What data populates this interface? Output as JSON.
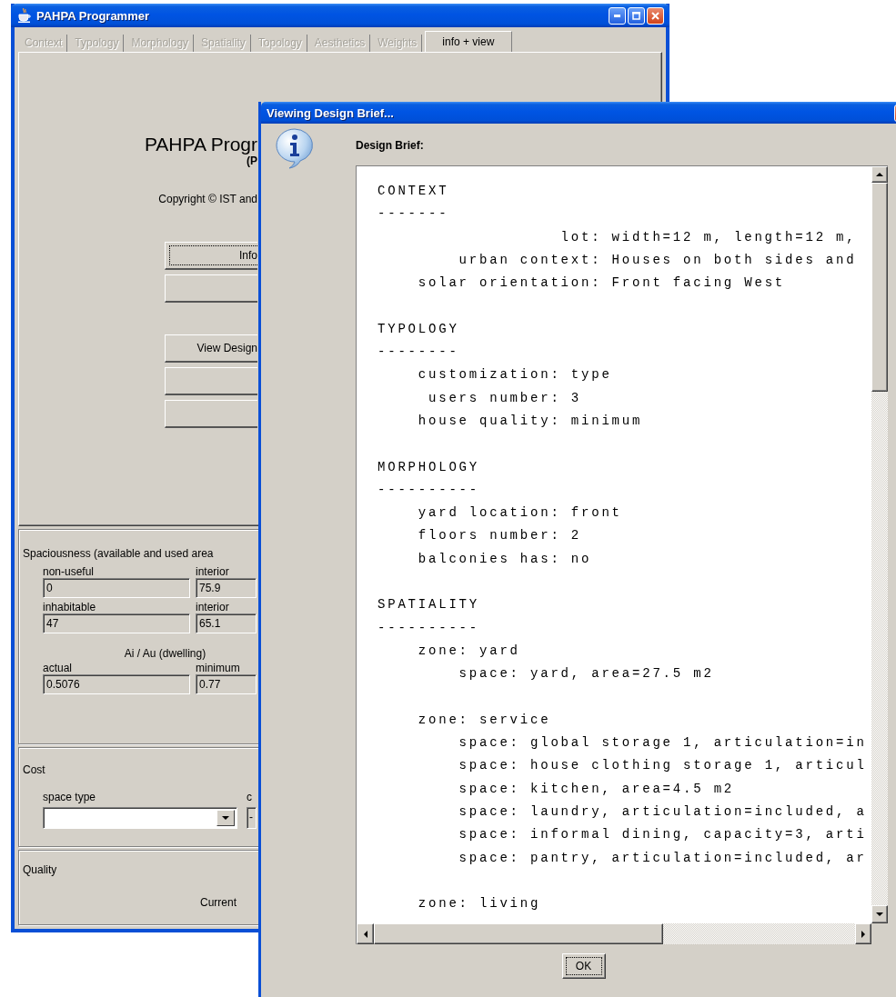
{
  "main_window": {
    "title": "PAHPA Programmer",
    "tabs": [
      {
        "label": "Context",
        "selected": false,
        "disabled": true
      },
      {
        "label": "Typology",
        "selected": false,
        "disabled": true
      },
      {
        "label": "Morphology",
        "selected": false,
        "disabled": true
      },
      {
        "label": "Spatiality",
        "selected": false,
        "disabled": true
      },
      {
        "label": "Topology",
        "selected": false,
        "disabled": true
      },
      {
        "label": "Aesthetics",
        "selected": false,
        "disabled": true
      },
      {
        "label": "Weights",
        "selected": false,
        "disabled": true
      },
      {
        "label": "info + view",
        "selected": true,
        "disabled": false
      }
    ],
    "about": {
      "title": "PAHPA Progr",
      "subtitle": "(P",
      "copyright": "Copyright © IST and"
    },
    "button_groups": [
      [
        {
          "label": "Info",
          "focused": true
        },
        {
          "focused": false
        }
      ],
      [
        {
          "label": "View Design",
          "focused": false
        },
        {
          "focused": false
        },
        {
          "focused": false
        }
      ]
    ],
    "spaciousness": {
      "title": "Spaciousness (available and used area",
      "rows": [
        [
          {
            "label": "non-useful",
            "value": "0"
          },
          {
            "label": "interior",
            "value": "75.9"
          }
        ],
        [
          {
            "label": "inhabitable",
            "value": "47"
          },
          {
            "label": "interior",
            "value": "65.1"
          }
        ]
      ],
      "ratio_title": "Ai / Au (dwelling)",
      "ratio_fields": [
        {
          "label": "actual",
          "value": "0.5076"
        },
        {
          "label": "minimum",
          "value": "0.77"
        }
      ]
    },
    "cost": {
      "title": "Cost",
      "space_type": {
        "label": "space type"
      },
      "column_2": {
        "label": "c",
        "value": "-"
      }
    },
    "quality": {
      "title": "Quality",
      "label": "Current"
    }
  },
  "dialog": {
    "title": "Viewing Design Brief...",
    "heading": "Design Brief:",
    "sections": [
      {
        "title": "CONTEXT",
        "rule": "-------",
        "kind": "aligned",
        "entries": [
          {
            "label": "lot:",
            "value": "width=12 m, length=12 m,"
          },
          {
            "label": "urban context:",
            "value": "Houses on both sides and"
          },
          {
            "label": "solar orientation:",
            "value": "Front facing West"
          }
        ]
      },
      {
        "title": "TYPOLOGY",
        "rule": "--------",
        "kind": "aligned",
        "entries": [
          {
            "label": "customization:",
            "value": "type"
          },
          {
            "label": "users number:",
            "value": "3"
          },
          {
            "label": "house quality:",
            "value": "minimum"
          }
        ]
      },
      {
        "title": "MORPHOLOGY",
        "rule": "----------",
        "kind": "indented",
        "entries": [
          {
            "label": "yard location:",
            "value": "front"
          },
          {
            "label": "floors number:",
            "value": "2"
          },
          {
            "label": "balconies has:",
            "value": "no"
          }
        ]
      },
      {
        "title": "SPATIALITY",
        "rule": "----------",
        "kind": "zones",
        "zones": [
          {
            "label": "zone: yard",
            "spaces": [
              "space: yard, area=27.5 m2"
            ]
          },
          {
            "label": "zone: service",
            "spaces": [
              "space: global storage 1, articulation=in",
              "space: house clothing storage 1, articul",
              "space: kitchen, area=4.5 m2",
              "space: laundry, articulation=included, a",
              "space: informal dining, capacity=3, arti",
              "space: pantry, articulation=included, ar"
            ]
          },
          {
            "label": "zone: living"
          }
        ]
      }
    ],
    "ok_button": "OK"
  }
}
